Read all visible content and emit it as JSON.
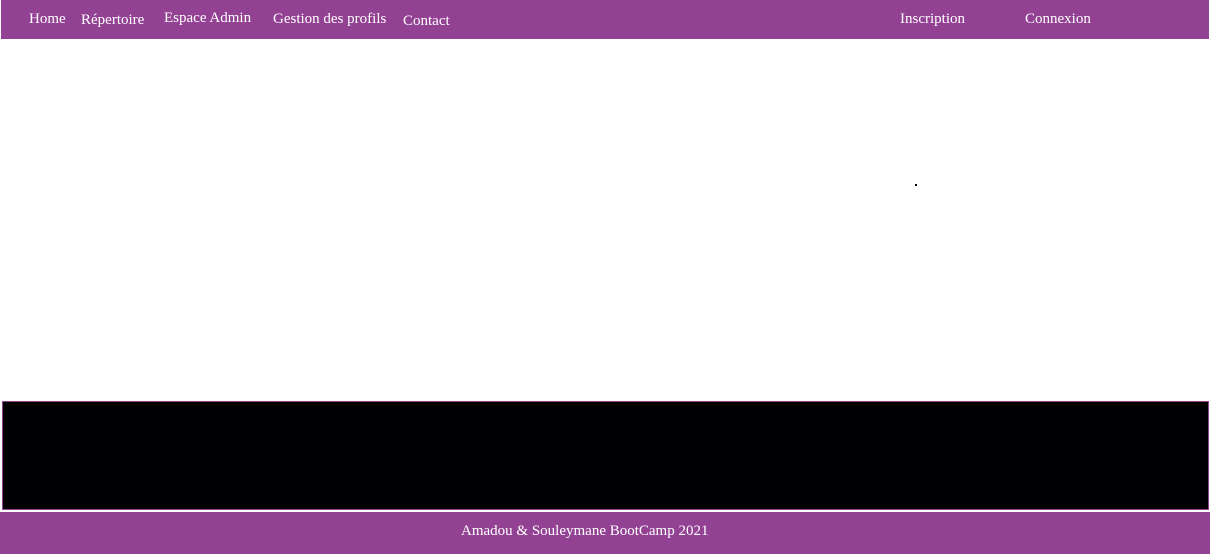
{
  "colors": {
    "navbar_bg": "#924193",
    "footer_bg": "#924193",
    "band_bg": "#000002",
    "text": "#ffffff"
  },
  "nav": {
    "left_items": [
      {
        "label": "Home"
      },
      {
        "label": "Répertoire"
      },
      {
        "label": "Espace Admin"
      },
      {
        "label": "Gestion des profils"
      },
      {
        "label": "Contact"
      }
    ],
    "right_items": [
      {
        "label": "Inscription"
      },
      {
        "label": "Connexion"
      }
    ]
  },
  "footer": {
    "text": "Amadou & Souleymane BootCamp 2021"
  }
}
